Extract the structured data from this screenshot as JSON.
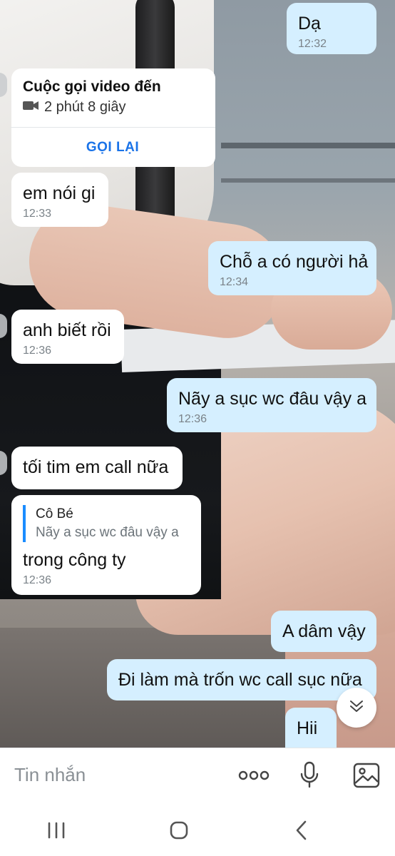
{
  "messages": {
    "m1": {
      "text": "Dạ",
      "time": "12:32"
    },
    "call": {
      "title": "Cuộc gọi video đến",
      "duration": "2 phút 8 giây",
      "action": "GỌI LẠI"
    },
    "m2": {
      "text": "em nói gi",
      "time": "12:33"
    },
    "m3": {
      "text": "Chỗ a có người hả",
      "time": "12:34"
    },
    "m4": {
      "text": "anh biết rồi",
      "time": "12:36"
    },
    "m5": {
      "text": "Nãy a sục wc đâu vậy a",
      "time": "12:36"
    },
    "m6": {
      "text": "tối tim em call nữa"
    },
    "m7": {
      "quote_name": "Cô Bé",
      "quote_text": "Nãy a sục wc đâu vậy a",
      "text": "trong công ty",
      "time": "12:36"
    },
    "m8": {
      "text": "A dâm vậy"
    },
    "m9": {
      "text": "Đi làm mà trốn wc call sục nữa"
    },
    "m10": {
      "text": "Hii"
    }
  },
  "input": {
    "placeholder": "Tin nhắn"
  },
  "icons": {
    "call": "video-camera-icon",
    "scroll": "chevron-double-down-icon",
    "more": "more-dots-icon",
    "mic": "microphone-icon",
    "image": "image-icon",
    "nav_recent": "recent-apps-icon",
    "nav_home": "home-icon",
    "nav_back": "back-icon"
  },
  "colors": {
    "incoming_bubble": "#ffffff",
    "outgoing_bubble": "#d5efff",
    "accent": "#1a73e8",
    "quote_bar": "#1a8cff"
  }
}
